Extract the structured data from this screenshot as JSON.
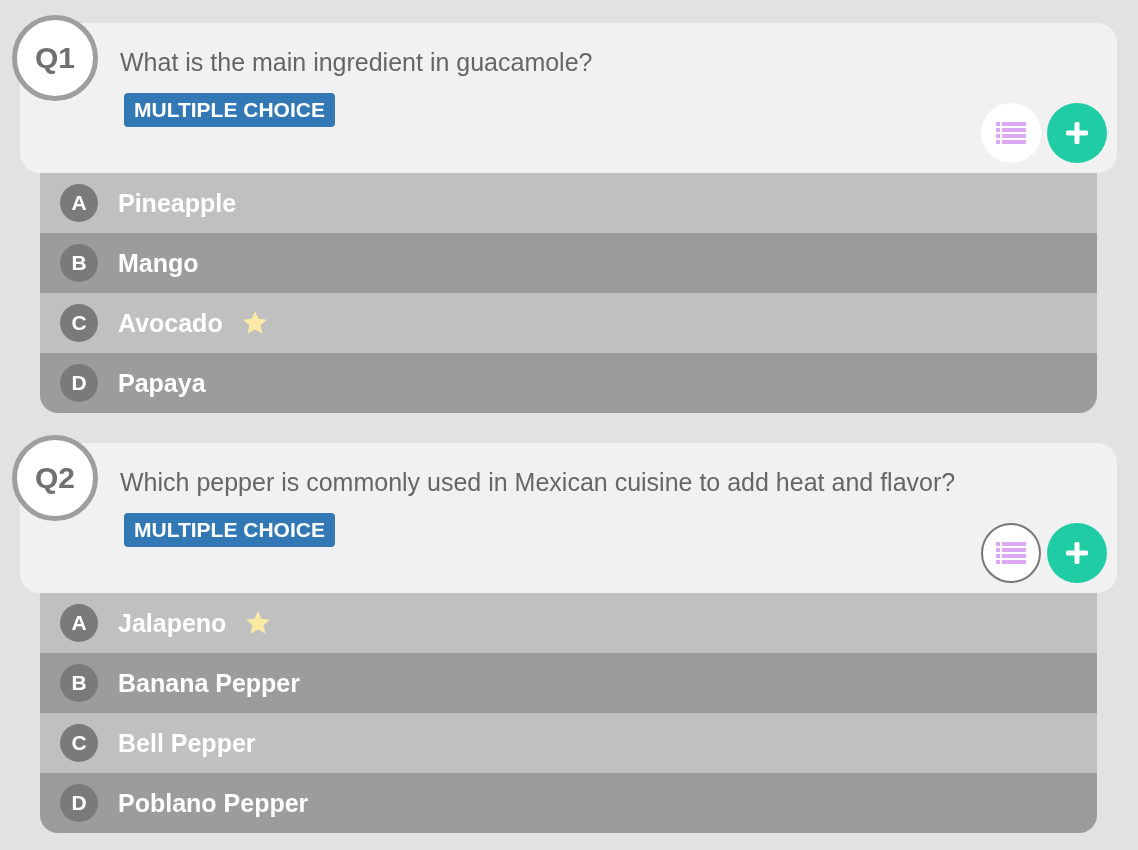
{
  "questions": [
    {
      "number": "Q1",
      "text": "What is the main ingredient in guacamole?",
      "type_label": "MULTIPLE CHOICE",
      "list_button_focused": false,
      "answers": [
        {
          "letter": "A",
          "text": "Pineapple",
          "correct": false
        },
        {
          "letter": "B",
          "text": "Mango",
          "correct": false
        },
        {
          "letter": "C",
          "text": "Avocado",
          "correct": true
        },
        {
          "letter": "D",
          "text": "Papaya",
          "correct": false
        }
      ]
    },
    {
      "number": "Q2",
      "text": "Which pepper is commonly used in Mexican cuisine to add heat and flavor?",
      "type_label": "MULTIPLE CHOICE",
      "list_button_focused": true,
      "answers": [
        {
          "letter": "A",
          "text": "Jalapeno",
          "correct": true
        },
        {
          "letter": "B",
          "text": "Banana Pepper",
          "correct": false
        },
        {
          "letter": "C",
          "text": "Bell Pepper",
          "correct": false
        },
        {
          "letter": "D",
          "text": "Poblano Pepper",
          "correct": false
        }
      ]
    }
  ]
}
